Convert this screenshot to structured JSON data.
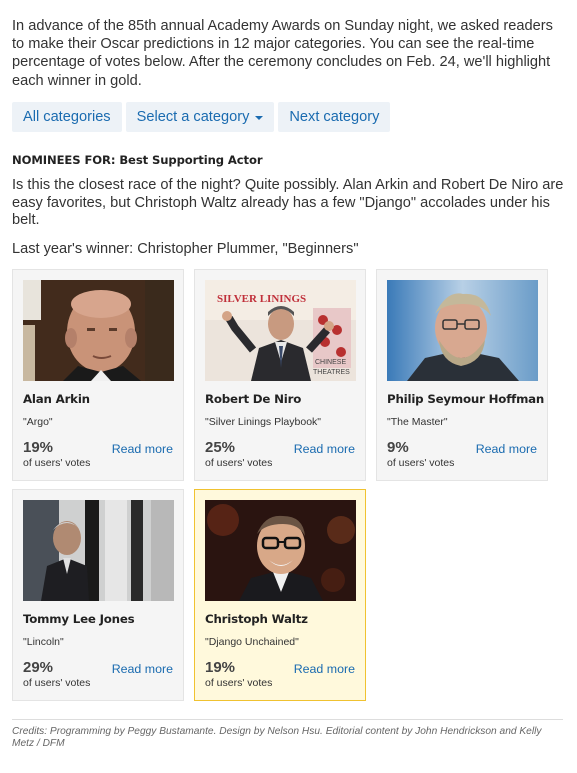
{
  "intro": "In advance of the 85th annual Academy Awards on Sunday night, we asked readers to make their Oscar predictions in 12 major categories. You can see the real-time percentage of votes below. After the ceremony concludes on Feb. 24, we'll highlight each winner in gold.",
  "nav": {
    "all": "All categories",
    "select": "Select a category",
    "next": "Next category"
  },
  "category": {
    "heading": "NOMINEES FOR: Best Supporting Actor",
    "description": "Is this the closest race of the night? Quite possibly. Alan Arkin and Robert De Niro are easy favorites, but Christoph Waltz already has a few \"Django\" accolades under his belt.",
    "last_winner": "Last year's winner: Christopher Plummer, \"Beginners\""
  },
  "nominees": [
    {
      "name": "Alan Arkin",
      "film": "\"Argo\"",
      "pct": "19%",
      "votes_label": "of users' votes",
      "link": "Read more",
      "winner": false
    },
    {
      "name": "Robert De Niro",
      "film": "\"Silver Linings Playbook\"",
      "pct": "25%",
      "votes_label": "of users' votes",
      "link": "Read more",
      "winner": false
    },
    {
      "name": "Philip Seymour Hoffman",
      "film": "\"The Master\"",
      "pct": "9%",
      "votes_label": "of users' votes",
      "link": "Read more",
      "winner": false
    },
    {
      "name": "Tommy Lee Jones",
      "film": "\"Lincoln\"",
      "pct": "29%",
      "votes_label": "of users' votes",
      "link": "Read more",
      "winner": false
    },
    {
      "name": "Christoph Waltz",
      "film": "\"Django Unchained\"",
      "pct": "19%",
      "votes_label": "of users' votes",
      "link": "Read more",
      "winner": true
    }
  ],
  "photo_text": {
    "silver_linings": "SILVER LININGS",
    "chinese": "CHINESE",
    "theatres": "THEATRES"
  },
  "credits": "Credits: Programming by Peggy Bustamante. Design by Nelson Hsu. Editorial content by John Hendrickson and Kelly Metz / DFM",
  "colors": {
    "link": "#1a6bb0",
    "nav_bg": "#edf2f7",
    "winner_bg": "#fff9dc",
    "winner_border": "#f0c230"
  }
}
